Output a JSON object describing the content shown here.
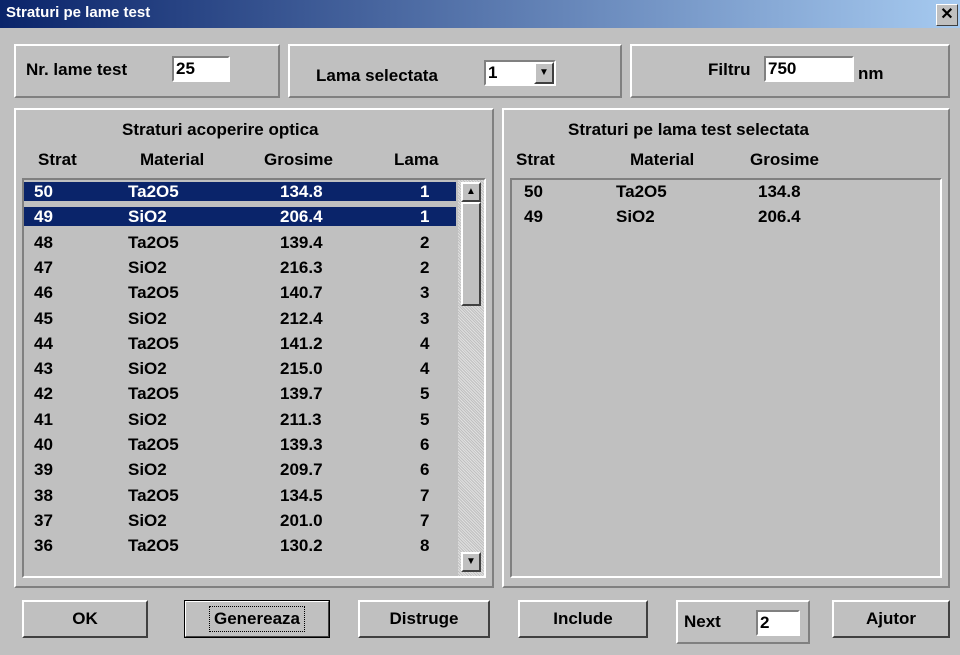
{
  "window": {
    "title": "Straturi pe lame test",
    "close_glyph": "✕"
  },
  "top": {
    "nr_label": "Nr. lame test",
    "nr_value": "25",
    "lama_label": "Lama selectata",
    "lama_value": "1",
    "filtru_label": "Filtru",
    "filtru_value": "750",
    "filtru_unit": "nm"
  },
  "left_panel": {
    "title": "Straturi acoperire optica",
    "headers": [
      "Strat",
      "Material",
      "Grosime",
      "Lama"
    ],
    "rows": [
      [
        "50",
        "Ta2O5",
        "134.8",
        "1"
      ],
      [
        "49",
        "SiO2",
        "206.4",
        "1"
      ],
      [
        "48",
        "Ta2O5",
        "139.4",
        "2"
      ],
      [
        "47",
        "SiO2",
        "216.3",
        "2"
      ],
      [
        "46",
        "Ta2O5",
        "140.7",
        "3"
      ],
      [
        "45",
        "SiO2",
        "212.4",
        "3"
      ],
      [
        "44",
        "Ta2O5",
        "141.2",
        "4"
      ],
      [
        "43",
        "SiO2",
        "215.0",
        "4"
      ],
      [
        "42",
        "Ta2O5",
        "139.7",
        "5"
      ],
      [
        "41",
        "SiO2",
        "211.3",
        "5"
      ],
      [
        "40",
        "Ta2O5",
        "139.3",
        "6"
      ],
      [
        "39",
        "SiO2",
        "209.7",
        "6"
      ],
      [
        "38",
        "Ta2O5",
        "134.5",
        "7"
      ],
      [
        "37",
        "SiO2",
        "201.0",
        "7"
      ],
      [
        "36",
        "Ta2O5",
        "130.2",
        "8"
      ]
    ],
    "selected_rows": [
      0,
      1
    ]
  },
  "right_panel": {
    "title": "Straturi pe lama test selectata",
    "headers": [
      "Strat",
      "Material",
      "Grosime"
    ],
    "rows": [
      [
        "50",
        "Ta2O5",
        "134.8"
      ],
      [
        "49",
        "SiO2",
        "206.4"
      ]
    ]
  },
  "buttons": {
    "ok": "OK",
    "genereaza": "Genereaza",
    "distruge": "Distruge",
    "include": "Include",
    "next": "Next",
    "next_value": "2",
    "ajutor": "Ajutor"
  },
  "icons": {
    "scroll_up": "▲",
    "scroll_down": "▼",
    "combo_arrow": "▼"
  }
}
